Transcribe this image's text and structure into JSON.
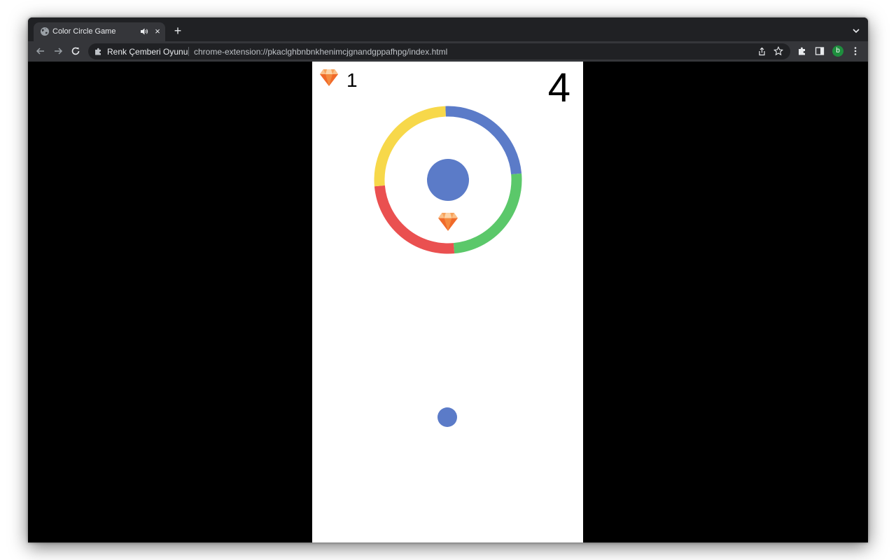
{
  "browser": {
    "tab_title": "Color Circle Game",
    "tab_close": "×",
    "new_tab": "+",
    "omnibox_site": "Renk Çemberi Oyunu",
    "omnibox_url": "chrome-extension://pkaclghbnbnkhenimcjgnandgppafhpg/index.html",
    "profile_initial": "b",
    "profile_color": "#1e8e3e"
  },
  "game": {
    "gem_count": "1",
    "score": "4",
    "ring_colors": {
      "blue": "#5b7bc8",
      "green": "#5bc86a",
      "red": "#ea5050",
      "yellow": "#f7d84a"
    },
    "center_ball_color": "#5b7bc8",
    "player_ball_color": "#5b7bc8",
    "gem_icon": "diamond-icon"
  }
}
